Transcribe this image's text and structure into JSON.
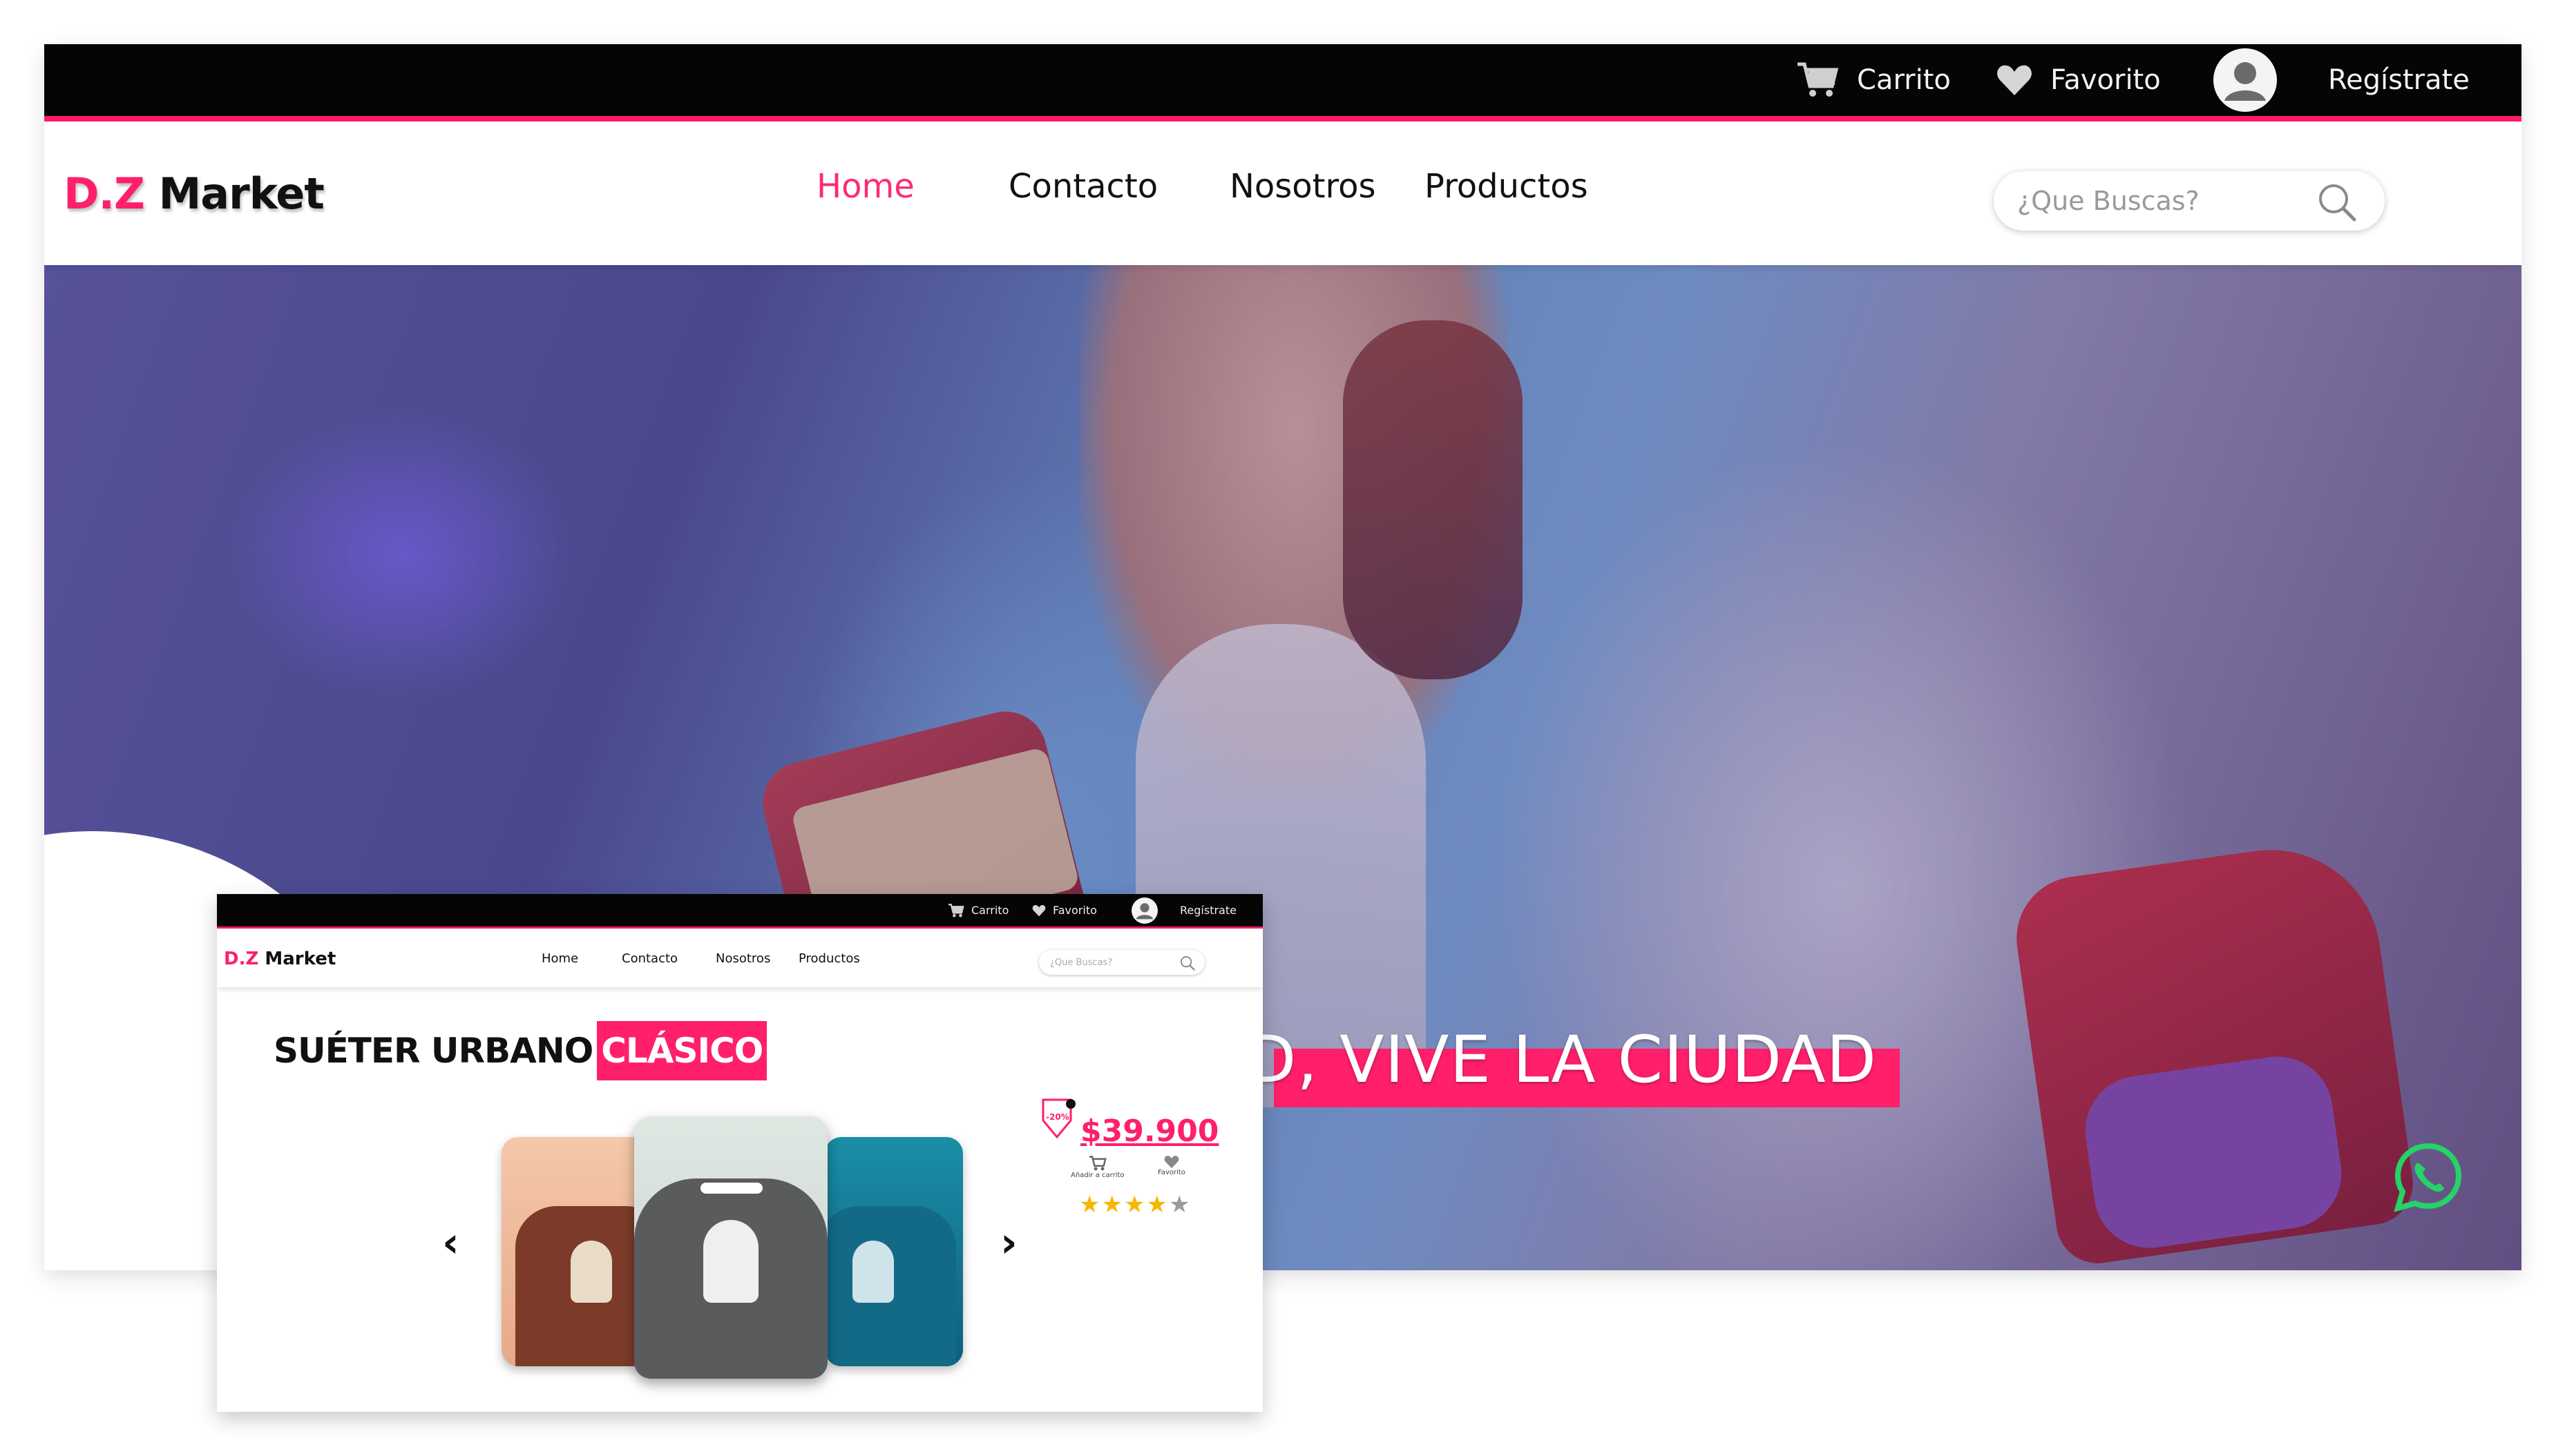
{
  "topbar": {
    "cart_label": "Carrito",
    "favorite_label": "Favorito",
    "register_label": "Regístrate"
  },
  "brand": {
    "prefix": "D.Z",
    "name": "Market"
  },
  "nav": {
    "items": [
      {
        "label": "Home",
        "active": true
      },
      {
        "label": "Contacto",
        "active": false
      },
      {
        "label": "Nosotros",
        "active": false
      },
      {
        "label": "Productos",
        "active": false
      }
    ]
  },
  "search": {
    "placeholder": "¿Que Buscas?"
  },
  "hero": {
    "headline": "D, VIVE LA CIUDAD"
  },
  "product": {
    "title_part1": "SUÉTER URBANO",
    "title_part2": "CLÁSICO",
    "discount_badge": "-20%",
    "price": "$39.900",
    "add_to_cart_label": "Añadir a carrito",
    "favorite_label": "Favorito",
    "rating": 4,
    "rating_max": 5,
    "prev_arrow": "‹",
    "next_arrow": "›"
  },
  "colors": {
    "accent": "#ff1f6a",
    "topbar_bg": "#050505",
    "text": "#111111",
    "whatsapp": "#25d366"
  }
}
